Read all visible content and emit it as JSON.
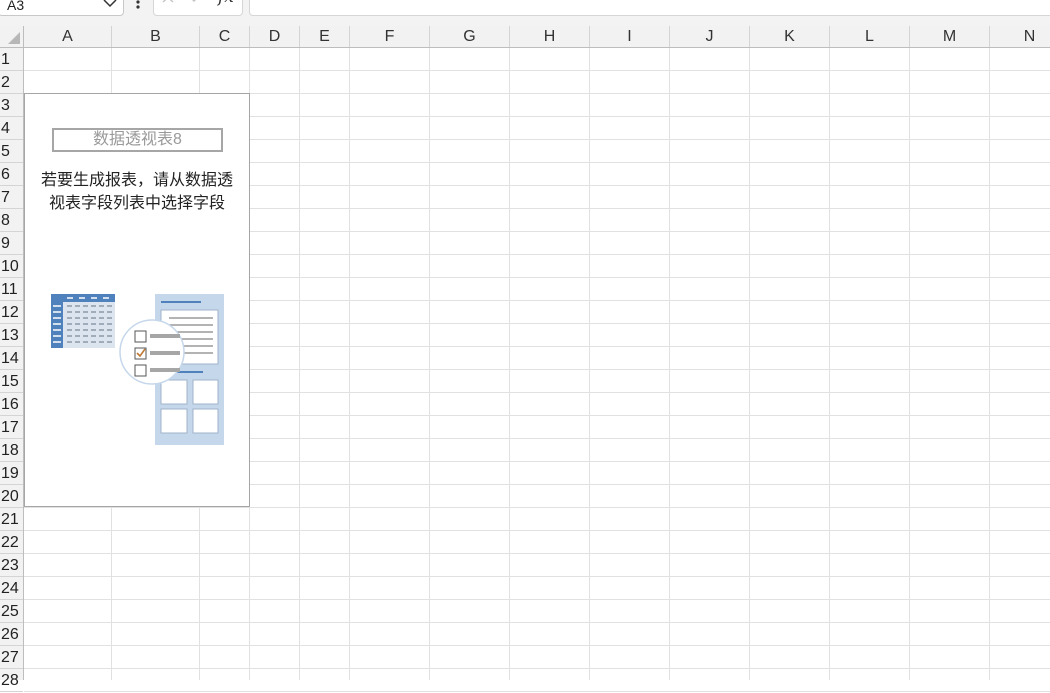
{
  "formula_bar": {
    "name_box": "A3",
    "formula": "",
    "fx_label": "fx"
  },
  "grid": {
    "columns": [
      "A",
      "B",
      "C",
      "D",
      "E",
      "F",
      "G",
      "H",
      "I",
      "J",
      "K",
      "L",
      "M",
      "N"
    ],
    "rows": [
      "1",
      "2",
      "3",
      "4",
      "5",
      "6",
      "7",
      "8",
      "9",
      "10",
      "11",
      "12",
      "13",
      "14",
      "15",
      "16",
      "17",
      "18",
      "19",
      "20",
      "21",
      "22",
      "23",
      "24",
      "25",
      "26",
      "27",
      "28"
    ]
  },
  "pivot_table": {
    "name": "数据透视表8",
    "message_line1": "若要生成报表，请从数据透",
    "message_line2": "视表字段列表中选择字段"
  },
  "colors": {
    "accent_blue": "#4f81bd",
    "panel_blue": "#c5d7eb",
    "check_orange": "#c07a36",
    "gridline": "#e1e1e1",
    "header_bg": "#f2f2f2"
  },
  "icons": [
    "chevron-down-icon",
    "more-vert-icon",
    "cancel-icon",
    "confirm-icon",
    "fx-icon",
    "select-all-icon"
  ]
}
